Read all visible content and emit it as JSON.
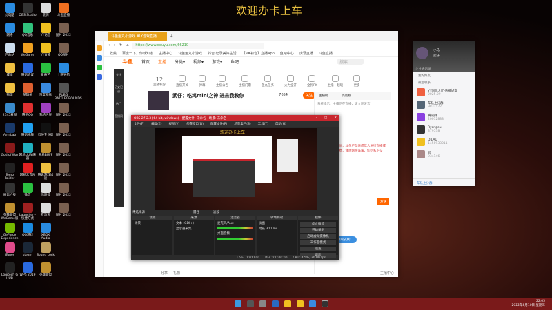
{
  "wallpaper_title": "欢迎办卡上车",
  "desktop_icons": [
    {
      "label": "此电脑",
      "color": "#2a8be0"
    },
    {
      "label": "网络",
      "color": "#2a8be0"
    },
    {
      "label": "回收站",
      "color": "#cde"
    },
    {
      "label": "成绩",
      "color": "#f0c040"
    },
    {
      "label": "物理",
      "color": "#f0c040"
    },
    {
      "label": "2345看图",
      "color": "#3a8acc"
    },
    {
      "label": "Aim Lab",
      "color": "#1a3a6a"
    },
    {
      "label": "God of War",
      "color": "#8a1a1a"
    },
    {
      "label": "Tomb Raider",
      "color": "#222"
    },
    {
      "label": "搬运六号",
      "color": "#333"
    },
    {
      "label": "英雄联盟WeGame版",
      "color": "#c09030"
    },
    {
      "label": "GeForce Experience",
      "color": "#76b900"
    },
    {
      "label": "iTunes",
      "color": "#e04a8a"
    },
    {
      "label": "Logitech G HUB",
      "color": "#222"
    },
    {
      "label": "OBS Studio",
      "color": "#333"
    },
    {
      "label": "QQ音乐",
      "color": "#31c27c"
    },
    {
      "label": "WeGame",
      "color": "#f0a020"
    },
    {
      "label": "腾讯会议",
      "color": "#2a6ae0"
    },
    {
      "label": "英雄杀",
      "color": "#e06030"
    },
    {
      "label": "腾讯QQ",
      "color": "#e03030"
    },
    {
      "label": "腾讯视频",
      "color": "#20a0f0"
    },
    {
      "label": "网易UU加速器",
      "color": "#20b0c0"
    },
    {
      "label": "网易云音乐",
      "color": "#e02020"
    },
    {
      "label": "微信",
      "color": "#2ac040"
    },
    {
      "label": "Launcher - 快捷方式",
      "color": "#a02020"
    },
    {
      "label": "QQ游戏",
      "color": "#1a8ae0"
    },
    {
      "label": "steam",
      "color": "#1b2838"
    },
    {
      "label": "WPS 2019",
      "color": "#2a6ae0"
    },
    {
      "label": "说明",
      "color": "#ddd"
    },
    {
      "label": "YY语音",
      "color": "#f0c020"
    },
    {
      "label": "YY直播",
      "color": "#f0c020"
    },
    {
      "label": "爱奇艺",
      "color": "#2ac040"
    },
    {
      "label": "百度网盘",
      "color": "#3a8ae0"
    },
    {
      "label": "我的世界",
      "color": "#a040c0"
    },
    {
      "label": "剪映专业版",
      "color": "#111"
    },
    {
      "label": "网易BUFF",
      "color": "#c09030"
    },
    {
      "label": "腾讯游戏加速",
      "color": "#f0c040"
    },
    {
      "label": "鸣谢号",
      "color": "#ddd"
    },
    {
      "label": "亚马逊",
      "color": "#ddd"
    },
    {
      "label": "XBOX Audio",
      "color": "#2a8be0"
    },
    {
      "label": "Sound Lock",
      "color": "#c0a060"
    },
    {
      "label": "英雄联盟",
      "color": "#c09030"
    },
    {
      "label": "斗鱼直播",
      "color": "#f07020"
    },
    {
      "label": "图片 2022",
      "color": "#7a6050"
    },
    {
      "label": "QQ图片",
      "color": "#7a6050"
    },
    {
      "label": "上网导航",
      "color": "#2a8be0"
    },
    {
      "label": "PUBG BATTLEGROUNDS",
      "color": "#555"
    },
    {
      "label": "图片 2022",
      "color": "#7a6050"
    },
    {
      "label": "图片 2022",
      "color": "#7a6050"
    },
    {
      "label": "图片 2022",
      "color": "#7a6050"
    },
    {
      "label": "图片 2022",
      "color": "#7a6050"
    },
    {
      "label": "图片 2022",
      "color": "#7a6050"
    },
    {
      "label": "图片 2022",
      "color": "#7a6050"
    }
  ],
  "browser": {
    "tab": "斗鱼鱼丸小游戏 #LY游戏直播",
    "url": "https://www.douyu.com/66210",
    "bookmarks": [
      "收藏",
      "百度一下，你就知道",
      "主播中心",
      "斗鱼鱼丸小游戏",
      "抖音·记录美好生活",
      "【9#初音】直播App",
      "鱼吧中心",
      "虎牙直播",
      "斗鱼直播"
    ],
    "nav": {
      "logo": "斗鱼",
      "items": [
        "首页",
        "直播",
        "分类▾",
        "视频▾",
        "游戏▾",
        "鱼吧"
      ],
      "search_placeholder": "搜索"
    },
    "sidebar": [
      "关注",
      "历史记录",
      "热门",
      "直播间"
    ],
    "tools": [
      {
        "label": "主播积分",
        "value": "12"
      },
      {
        "label": "直播开关"
      },
      {
        "label": "弹幕"
      },
      {
        "label": "主播公告"
      },
      {
        "label": "主播门票"
      },
      {
        "label": "鱼丸任务"
      },
      {
        "label": "火力全开"
      },
      {
        "label": "全民PK"
      },
      {
        "label": "主播一起玩"
      },
      {
        "label": "更多"
      }
    ],
    "room": {
      "title": "武仔：吃鸡mini之神 进来我教你",
      "follow": "关注",
      "count": "7654"
    },
    "chat": {
      "tabs": [
        "主播榜",
        "高能榜"
      ],
      "notice": "系统提示：主播正在直播，请文明发言",
      "red_text": "欢迎来到本直播间，斗鱼严禁未成年人进行直播或打赏。请理性消费，谨防网络诈骗，切勿私下交易。",
      "send": "发送",
      "bubble": "快来免费领取皮肤！"
    },
    "bottom": [
      "分享",
      "礼物",
      "主播中心"
    ]
  },
  "obs": {
    "title": "OBS 27.2.3 (64 bit, windows) - 配置文件: 未命名 - 场景: 未命名",
    "menu": [
      "文件(F)",
      "编辑(E)",
      "视图(V)",
      "停靠窗口(D)",
      "配置文件(P)",
      "场景集合(S)",
      "工具(T)",
      "帮助(H)"
    ],
    "preview_title": "欢迎办卡上车",
    "no_source": "未选择源",
    "scene_buttons": [
      "属性",
      "滤镜"
    ],
    "docks": {
      "scenes": "场景",
      "sources": "来源",
      "mixer": "混音器",
      "transitions": "转场特效",
      "controls": "控件"
    },
    "scene_items": [
      "场景"
    ],
    "source_items": [
      "文本 (GDI+)",
      "显示器采集"
    ],
    "mixer_items": [
      "麦克风/Aux",
      "桌面音频"
    ],
    "transition": "淡出",
    "duration_label": "时长",
    "duration": "300 ms",
    "controls": [
      "停止推流",
      "开始录制",
      "启动虚拟摄像机",
      "工作室模式",
      "设置",
      "退出"
    ],
    "status": [
      "LIVE: 00:00:00",
      "REC: 00:00:00",
      "CPU: 4.5%, 30.00 fps"
    ]
  },
  "qq": {
    "name": "小马",
    "signature": "武仔",
    "search": "企业通讯录",
    "groups": [
      "我的好友",
      "最近联系"
    ],
    "contacts": [
      {
        "name": "YY国际大厅·热播好友",
        "sub": "2025.09+",
        "color": "#f06040"
      },
      {
        "name": "车队上分群",
        "sub": "9832172",
        "color": "#567"
      },
      {
        "name": "腾讯群",
        "sub": "20012888",
        "color": "#8a40e0"
      },
      {
        "name": "Ryongeu",
        "sub": "379538",
        "color": "#333"
      },
      {
        "name": "DJLAU",
        "sub": "1450933011",
        "color": "#f0c020"
      },
      {
        "name": "智",
        "sub": "934146",
        "color": "#a88"
      }
    ],
    "footer": "车队上分群"
  },
  "taskbar": {
    "time": "22:05",
    "date": "2022年8月10日 星期三"
  }
}
